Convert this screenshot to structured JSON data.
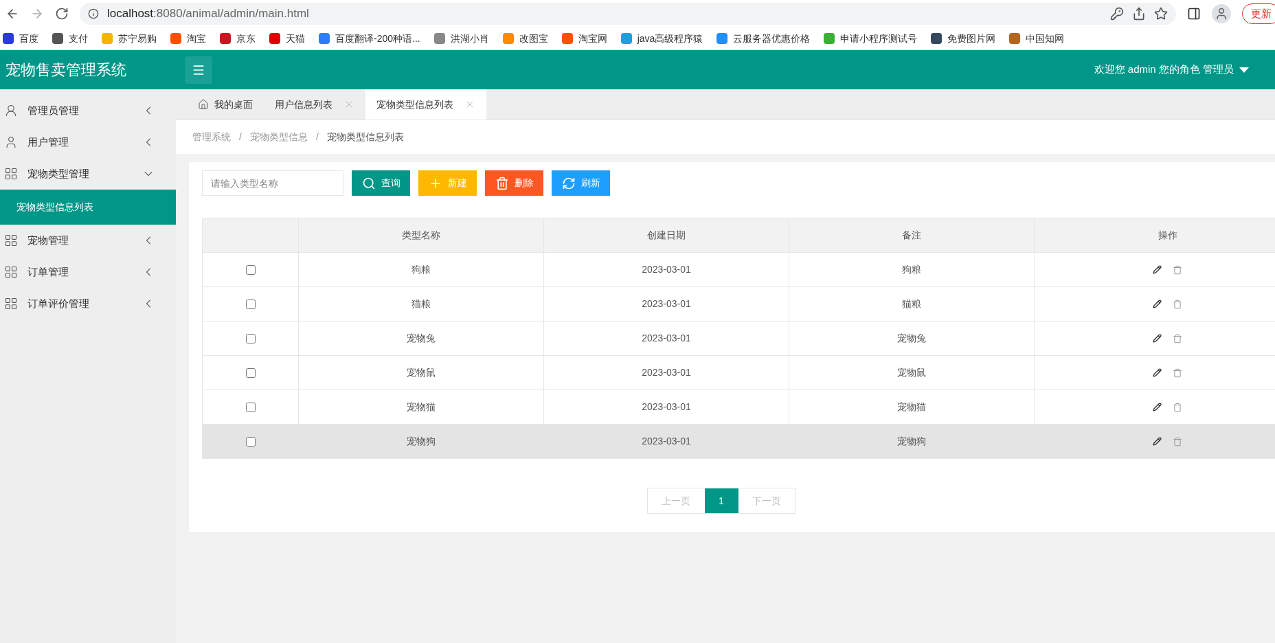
{
  "browser": {
    "url_host": "localhost",
    "url_rest": ":8080/animal/admin/main.html",
    "update_button": "更新",
    "bookmarks": [
      {
        "label": "百度",
        "color": "#2b3bd8"
      },
      {
        "label": "支付",
        "color": "#555555"
      },
      {
        "label": "苏宁易购",
        "color": "#f5b400"
      },
      {
        "label": "淘宝",
        "color": "#ff5000"
      },
      {
        "label": "京东",
        "color": "#c81623"
      },
      {
        "label": "天猫",
        "color": "#e00000"
      },
      {
        "label": "百度翻译-200种语...",
        "color": "#2c7ef8"
      },
      {
        "label": "洪湖小肖",
        "color": "#888888"
      },
      {
        "label": "改图宝",
        "color": "#ff8a00"
      },
      {
        "label": "淘宝网",
        "color": "#ff5000"
      },
      {
        "label": "java高级程序猿",
        "color": "#20a0da"
      },
      {
        "label": "云服务器优惠价格",
        "color": "#1e90ff"
      },
      {
        "label": "申请小程序测试号",
        "color": "#3cb034"
      },
      {
        "label": "免费图片网",
        "color": "#34495e"
      },
      {
        "label": "中国知网",
        "color": "#b5651d"
      }
    ]
  },
  "header": {
    "title": "宠物售卖管理系统",
    "user_info": "欢迎您 admin 您的角色 管理员"
  },
  "sidebar": {
    "items": [
      {
        "label": "管理员管理",
        "kind": "admin",
        "expanded": false
      },
      {
        "label": "用户管理",
        "kind": "user",
        "expanded": false
      },
      {
        "label": "宠物类型管理",
        "kind": "module",
        "expanded": true,
        "children": [
          {
            "label": "宠物类型信息列表",
            "selected": true
          }
        ]
      },
      {
        "label": "宠物管理",
        "kind": "module",
        "expanded": false
      },
      {
        "label": "订单管理",
        "kind": "module",
        "expanded": false
      },
      {
        "label": "订单评价管理",
        "kind": "module",
        "expanded": false
      }
    ]
  },
  "tabs": [
    {
      "label": "我的桌面",
      "kind": "home",
      "selected": false
    },
    {
      "label": "用户信息列表",
      "kind": "closable",
      "selected": false
    },
    {
      "label": "宠物类型信息列表",
      "kind": "closable",
      "selected": true
    }
  ],
  "breadcrumb": {
    "separator": "/",
    "items": [
      "管理系统",
      "宠物类型信息",
      "宠物类型信息列表"
    ]
  },
  "toolbar": {
    "search": {
      "placeholder": "请输入类型名称"
    },
    "buttons": [
      {
        "label": "查询",
        "kind": "search"
      },
      {
        "label": "新建",
        "kind": "add"
      },
      {
        "label": "删除",
        "kind": "delete"
      },
      {
        "label": "刷新",
        "kind": "refresh"
      }
    ]
  },
  "table": {
    "columns": [
      "类型名称",
      "创建日期",
      "备注",
      "操作"
    ],
    "rows": [
      {
        "checked": false,
        "hovered": false,
        "cells": [
          "狗粮",
          "2023-03-01",
          "狗粮"
        ]
      },
      {
        "checked": false,
        "hovered": false,
        "cells": [
          "猫粮",
          "2023-03-01",
          "猫粮"
        ]
      },
      {
        "checked": false,
        "hovered": false,
        "cells": [
          "宠物兔",
          "2023-03-01",
          "宠物兔"
        ]
      },
      {
        "checked": false,
        "hovered": false,
        "cells": [
          "宠物鼠",
          "2023-03-01",
          "宠物鼠"
        ]
      },
      {
        "checked": false,
        "hovered": false,
        "cells": [
          "宠物猫",
          "2023-03-01",
          "宠物猫"
        ]
      },
      {
        "checked": false,
        "hovered": true,
        "cells": [
          "宠物狗",
          "2023-03-01",
          "宠物狗"
        ]
      }
    ]
  },
  "pagination": {
    "prev": {
      "label": "上一页",
      "disabled": true
    },
    "pages": [
      {
        "label": "1",
        "selected": true
      }
    ],
    "next": {
      "label": "下一页",
      "disabled": true
    }
  }
}
